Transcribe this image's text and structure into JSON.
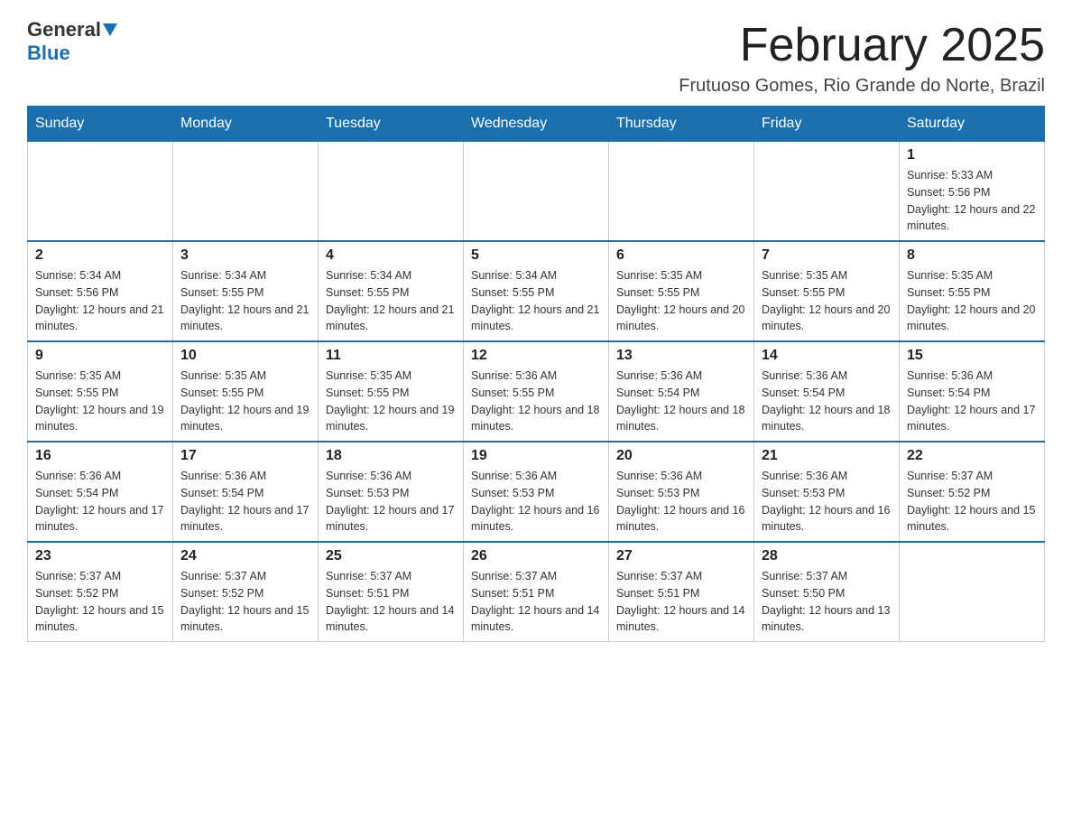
{
  "header": {
    "logo_general": "General",
    "logo_blue": "Blue",
    "month_title": "February 2025",
    "location": "Frutuoso Gomes, Rio Grande do Norte, Brazil"
  },
  "days_of_week": [
    "Sunday",
    "Monday",
    "Tuesday",
    "Wednesday",
    "Thursday",
    "Friday",
    "Saturday"
  ],
  "weeks": [
    {
      "days": [
        {
          "number": "",
          "info": ""
        },
        {
          "number": "",
          "info": ""
        },
        {
          "number": "",
          "info": ""
        },
        {
          "number": "",
          "info": ""
        },
        {
          "number": "",
          "info": ""
        },
        {
          "number": "",
          "info": ""
        },
        {
          "number": "1",
          "info": "Sunrise: 5:33 AM\nSunset: 5:56 PM\nDaylight: 12 hours and 22 minutes."
        }
      ]
    },
    {
      "days": [
        {
          "number": "2",
          "info": "Sunrise: 5:34 AM\nSunset: 5:56 PM\nDaylight: 12 hours and 21 minutes."
        },
        {
          "number": "3",
          "info": "Sunrise: 5:34 AM\nSunset: 5:55 PM\nDaylight: 12 hours and 21 minutes."
        },
        {
          "number": "4",
          "info": "Sunrise: 5:34 AM\nSunset: 5:55 PM\nDaylight: 12 hours and 21 minutes."
        },
        {
          "number": "5",
          "info": "Sunrise: 5:34 AM\nSunset: 5:55 PM\nDaylight: 12 hours and 21 minutes."
        },
        {
          "number": "6",
          "info": "Sunrise: 5:35 AM\nSunset: 5:55 PM\nDaylight: 12 hours and 20 minutes."
        },
        {
          "number": "7",
          "info": "Sunrise: 5:35 AM\nSunset: 5:55 PM\nDaylight: 12 hours and 20 minutes."
        },
        {
          "number": "8",
          "info": "Sunrise: 5:35 AM\nSunset: 5:55 PM\nDaylight: 12 hours and 20 minutes."
        }
      ]
    },
    {
      "days": [
        {
          "number": "9",
          "info": "Sunrise: 5:35 AM\nSunset: 5:55 PM\nDaylight: 12 hours and 19 minutes."
        },
        {
          "number": "10",
          "info": "Sunrise: 5:35 AM\nSunset: 5:55 PM\nDaylight: 12 hours and 19 minutes."
        },
        {
          "number": "11",
          "info": "Sunrise: 5:35 AM\nSunset: 5:55 PM\nDaylight: 12 hours and 19 minutes."
        },
        {
          "number": "12",
          "info": "Sunrise: 5:36 AM\nSunset: 5:55 PM\nDaylight: 12 hours and 18 minutes."
        },
        {
          "number": "13",
          "info": "Sunrise: 5:36 AM\nSunset: 5:54 PM\nDaylight: 12 hours and 18 minutes."
        },
        {
          "number": "14",
          "info": "Sunrise: 5:36 AM\nSunset: 5:54 PM\nDaylight: 12 hours and 18 minutes."
        },
        {
          "number": "15",
          "info": "Sunrise: 5:36 AM\nSunset: 5:54 PM\nDaylight: 12 hours and 17 minutes."
        }
      ]
    },
    {
      "days": [
        {
          "number": "16",
          "info": "Sunrise: 5:36 AM\nSunset: 5:54 PM\nDaylight: 12 hours and 17 minutes."
        },
        {
          "number": "17",
          "info": "Sunrise: 5:36 AM\nSunset: 5:54 PM\nDaylight: 12 hours and 17 minutes."
        },
        {
          "number": "18",
          "info": "Sunrise: 5:36 AM\nSunset: 5:53 PM\nDaylight: 12 hours and 17 minutes."
        },
        {
          "number": "19",
          "info": "Sunrise: 5:36 AM\nSunset: 5:53 PM\nDaylight: 12 hours and 16 minutes."
        },
        {
          "number": "20",
          "info": "Sunrise: 5:36 AM\nSunset: 5:53 PM\nDaylight: 12 hours and 16 minutes."
        },
        {
          "number": "21",
          "info": "Sunrise: 5:36 AM\nSunset: 5:53 PM\nDaylight: 12 hours and 16 minutes."
        },
        {
          "number": "22",
          "info": "Sunrise: 5:37 AM\nSunset: 5:52 PM\nDaylight: 12 hours and 15 minutes."
        }
      ]
    },
    {
      "days": [
        {
          "number": "23",
          "info": "Sunrise: 5:37 AM\nSunset: 5:52 PM\nDaylight: 12 hours and 15 minutes."
        },
        {
          "number": "24",
          "info": "Sunrise: 5:37 AM\nSunset: 5:52 PM\nDaylight: 12 hours and 15 minutes."
        },
        {
          "number": "25",
          "info": "Sunrise: 5:37 AM\nSunset: 5:51 PM\nDaylight: 12 hours and 14 minutes."
        },
        {
          "number": "26",
          "info": "Sunrise: 5:37 AM\nSunset: 5:51 PM\nDaylight: 12 hours and 14 minutes."
        },
        {
          "number": "27",
          "info": "Sunrise: 5:37 AM\nSunset: 5:51 PM\nDaylight: 12 hours and 14 minutes."
        },
        {
          "number": "28",
          "info": "Sunrise: 5:37 AM\nSunset: 5:50 PM\nDaylight: 12 hours and 13 minutes."
        },
        {
          "number": "",
          "info": ""
        }
      ]
    }
  ]
}
